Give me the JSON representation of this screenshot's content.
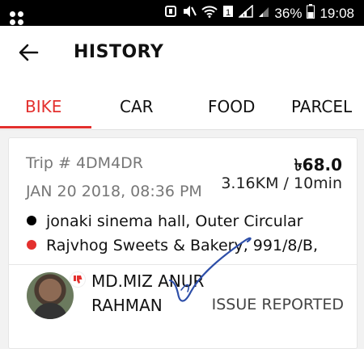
{
  "status_bar": {
    "battery": "36%",
    "time": "19:08",
    "sim": "1"
  },
  "header": {
    "title": "HISTORY"
  },
  "tabs": [
    {
      "label": "BIKE",
      "active": true
    },
    {
      "label": "CAR",
      "active": false
    },
    {
      "label": "FOOD",
      "active": false
    },
    {
      "label": "PARCEL",
      "active": false
    }
  ],
  "trip": {
    "id": "Trip # 4DM4DR",
    "date": "JAN 20 2018, 08:36 PM",
    "fare": "৳68.0",
    "distance_time": "3.16KM / 10min",
    "pickup": "jonaki sinema hall, Outer Circular",
    "dropoff": "Rajvhog Sweets & Bakery, 991/8/B,",
    "driver_name": "MD.MIZ ANUR RAHMAN",
    "status": "ISSUE REPORTED"
  },
  "colors": {
    "accent": "#e3302e",
    "pickup_dot": "#000000",
    "dropoff_dot": "#e3302e"
  },
  "icons": {
    "back": "arrow-left-icon",
    "reported": "thumbs-down-icon",
    "checkmark": "handwritten-check-icon"
  }
}
